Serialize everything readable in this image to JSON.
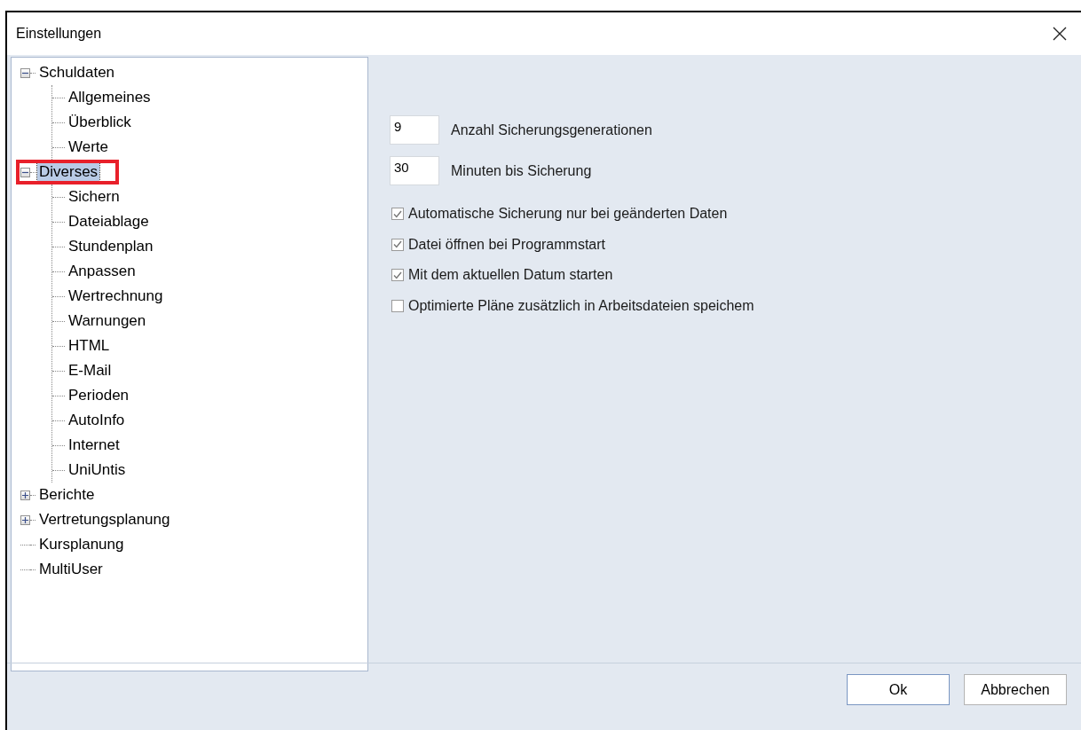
{
  "window": {
    "title": "Einstellungen"
  },
  "tree": [
    {
      "label": "Schuldaten",
      "expanded": true,
      "selected": false,
      "marked": false,
      "children": [
        {
          "label": "Allgemeines",
          "selected": false
        },
        {
          "label": "Überblick",
          "selected": false
        },
        {
          "label": "Werte",
          "selected": false
        }
      ]
    },
    {
      "label": "Diverses",
      "expanded": true,
      "selected": true,
      "marked": true,
      "children": [
        {
          "label": "Sichern",
          "selected": false
        },
        {
          "label": "Dateiablage",
          "selected": false
        },
        {
          "label": "Stundenplan",
          "selected": false
        },
        {
          "label": "Anpassen",
          "selected": false
        },
        {
          "label": "Wertrechnung",
          "selected": false
        },
        {
          "label": "Warnungen",
          "selected": false
        },
        {
          "label": "HTML",
          "selected": false
        },
        {
          "label": "E-Mail",
          "selected": false
        },
        {
          "label": "Perioden",
          "selected": false
        },
        {
          "label": "AutoInfo",
          "selected": false
        },
        {
          "label": "Internet",
          "selected": false
        },
        {
          "label": "UniUntis",
          "selected": false
        }
      ]
    },
    {
      "label": "Berichte",
      "expanded": false,
      "selected": false,
      "marked": false
    },
    {
      "label": "Vertretungsplanung",
      "expanded": false,
      "selected": false,
      "marked": false
    },
    {
      "label": "Kursplanung",
      "selected": false,
      "marked": false
    },
    {
      "label": "MultiUser",
      "selected": false,
      "marked": false
    }
  ],
  "fields": [
    {
      "value": "9",
      "label": "Anzahl Sicherungsgenerationen"
    },
    {
      "value": "30",
      "label": "Minuten bis Sicherung"
    }
  ],
  "options": [
    {
      "label": "Automatische Sicherung nur bei geänderten Daten",
      "checked": true
    },
    {
      "label": "Datei öffnen bei Programmstart",
      "checked": true
    },
    {
      "label": "Mit dem aktuellen Datum starten",
      "checked": true
    },
    {
      "label": "Optimierte Pläne zusätzlich in Arbeitsdateien speichem",
      "checked": false
    }
  ],
  "buttons": [
    {
      "label": "Ok",
      "kind": "default"
    },
    {
      "label": "Abbrechen",
      "kind": "normal"
    }
  ]
}
